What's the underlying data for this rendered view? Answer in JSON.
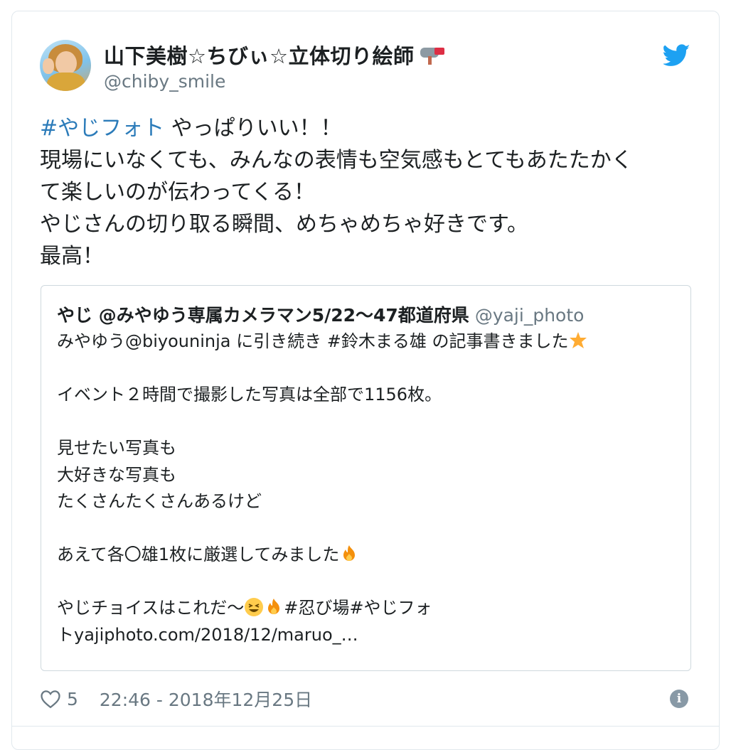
{
  "author": {
    "display_name": "山下美樹☆ちびぃ☆立体切り絵師",
    "handle": "@chiby_smile",
    "avatar_icon": "user-avatar",
    "badge_icon": "mailbox-icon"
  },
  "tweet": {
    "hashtag": "#やじフォト",
    "line1_rest": " やっぱりいい！！",
    "line2": "現場にいなくても、みんなの表情も空気感もとてもあたたかく",
    "line3": "て楽しいのが伝わってくる！",
    "line4": "やじさんの切り取る瞬間、めちゃめちゃ好きです。",
    "line5": "最高！"
  },
  "quote": {
    "name": "やじ @みやゆう専属カメラマン5/22〜47都道府県",
    "handle": "@yaji_photo",
    "line1": "みやゆう@biyouninja に引き続き #鈴木まる雄 の記事書きました",
    "line3": "イベント２時間で撮影した写真は全部で1156枚。",
    "line5": "見せたい写真も",
    "line6": "大好きな写真も",
    "line7": "たくさんたくさんあるけど",
    "line9": "あえて各〇雄1枚に厳選してみました",
    "line11_a": "やじチョイスはこれだ〜",
    "line11_b": "#忍び場#やじフォ",
    "line12": "トyajiphoto.com/2018/12/maruo_…"
  },
  "footer": {
    "likes": "5",
    "timestamp": "22:46 - 2018年12月25日"
  },
  "colors": {
    "link": "#2b7bb9",
    "twitter_blue": "#1da1f2",
    "muted": "#697882"
  }
}
